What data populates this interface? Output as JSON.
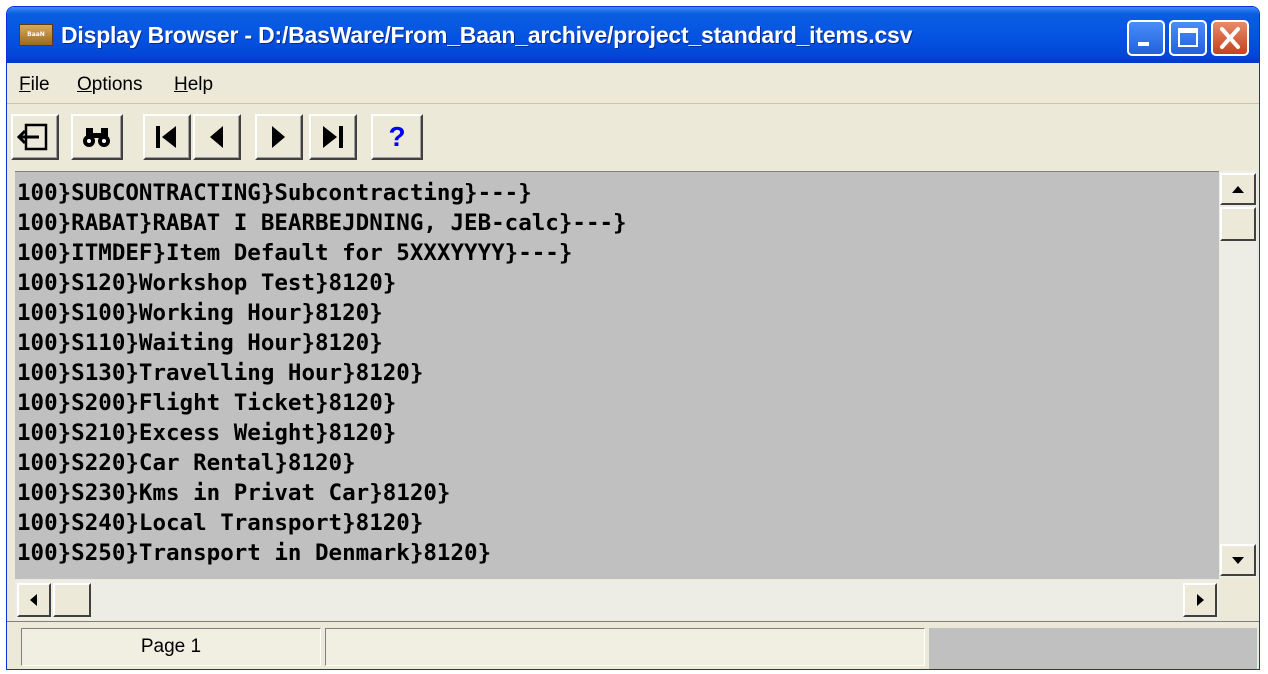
{
  "window": {
    "title": "Display Browser - D:/BasWare/From_Baan_archive/project_standard_items.csv",
    "app_icon_text": "BaaN"
  },
  "menu": {
    "file": {
      "accel": "F",
      "rest": "ile"
    },
    "options": {
      "accel": "O",
      "rest": "ptions"
    },
    "help": {
      "accel": "H",
      "rest": "elp"
    }
  },
  "toolbar": {
    "help_glyph": "?",
    "icons": [
      "exit-icon",
      "find-icon",
      "first-record-icon",
      "previous-record-icon",
      "next-record-icon",
      "last-record-icon",
      "help-icon"
    ]
  },
  "content": {
    "lines": [
      "100}SUBCONTRACTING}Subcontracting}---}",
      "100}RABAT}RABAT I BEARBEJDNING, JEB-calc}---}",
      "100}ITMDEF}Item Default for 5XXXYYYY}---}",
      "100}S120}Workshop Test}8120}",
      "100}S100}Working Hour}8120}",
      "100}S110}Waiting Hour}8120}",
      "100}S130}Travelling Hour}8120}",
      "100}S200}Flight Ticket}8120}",
      "100}S210}Excess Weight}8120}",
      "100}S220}Car Rental}8120}",
      "100}S230}Kms in Privat Car}8120}",
      "100}S240}Local Transport}8120}",
      "100}S250}Transport in Denmark}8120}"
    ]
  },
  "status": {
    "page": "Page 1",
    "message": ""
  },
  "colors": {
    "titlebar": "#0554e3",
    "content_bg": "#c0c0c0",
    "chrome": "#ece9d8",
    "help_glyph": "#0000ff",
    "close_button": "#c6421b"
  }
}
